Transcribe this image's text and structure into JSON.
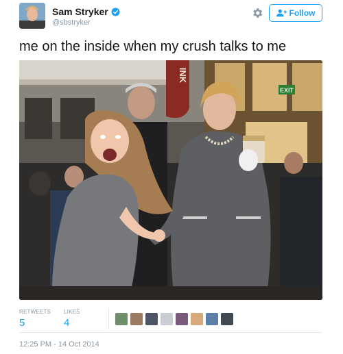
{
  "tweet": {
    "display_name": "Sam Stryker",
    "handle": "@sbstryker",
    "follow_label": "Follow",
    "text": "me on the inside when my crush talks to me",
    "photo": {
      "sign_text": "INK",
      "exit_sign": "EXIT"
    },
    "stats": {
      "retweets_label": "RETWEETS",
      "retweets_value": "5",
      "likes_label": "LIKES",
      "likes_value": "4"
    },
    "timestamp": "12:25 PM - 14 Oct 2014"
  },
  "colors": {
    "accent": "#1da1f2",
    "text": "#14171a",
    "muted": "#8899a6",
    "divider": "#e1e8ed"
  },
  "icons": [
    "verified-badge-icon",
    "gear-icon",
    "follow-person-plus-icon"
  ]
}
